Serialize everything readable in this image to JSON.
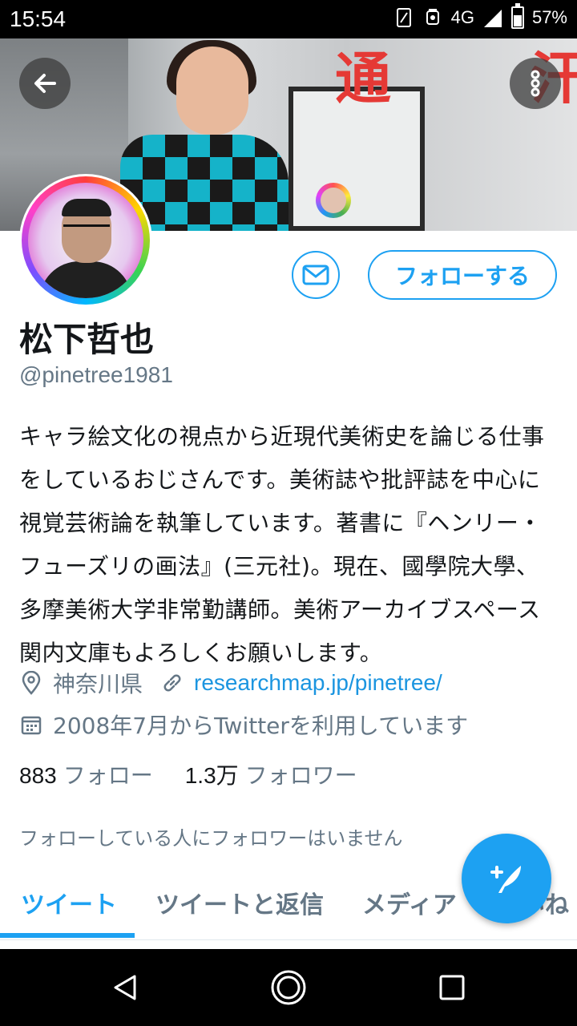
{
  "status_bar": {
    "time": "15:54",
    "network": "4G",
    "battery": "57%",
    "battery_level": 0.57
  },
  "header": {
    "back_icon": "arrow-left-icon",
    "more_icon": "more-vertical-icon",
    "banner_text_1": "通",
    "banner_text_2": "汗"
  },
  "profile": {
    "name": "松下哲也",
    "handle": "@pinetree1981",
    "bio": "キャラ絵文化の視点から近現代美術史を論じる仕事をしているおじさんです。美術誌や批評誌を中心に視覚芸術論を執筆しています。著書に『ヘンリー・フューズリの画法』(三元社)。現在、國學院大學、多摩美術大学非常勤講師。美術アーカイブスペース関内文庫もよろしくお願いします。",
    "location": "神奈川県",
    "website": "researchmap.jp/pinetree/",
    "joined": "2008年7月からTwitterを利用しています",
    "following_count": "883",
    "following_label": "フォロー",
    "followers_count": "1.3万",
    "followers_label": "フォロワー",
    "followed_by": "フォローしている人にフォロワーはいません"
  },
  "actions": {
    "follow_label": "フォローする",
    "message_icon": "envelope-icon"
  },
  "tabs": [
    {
      "label": "ツイート"
    },
    {
      "label": "ツイートと返信"
    },
    {
      "label": "メディア"
    },
    {
      "label": "いいね"
    }
  ],
  "fab": {
    "icon": "compose-feather-icon"
  },
  "colors": {
    "accent": "#1da1f2",
    "link": "#1b95e0",
    "secondary_text": "#657786",
    "primary_text": "#14171a"
  }
}
